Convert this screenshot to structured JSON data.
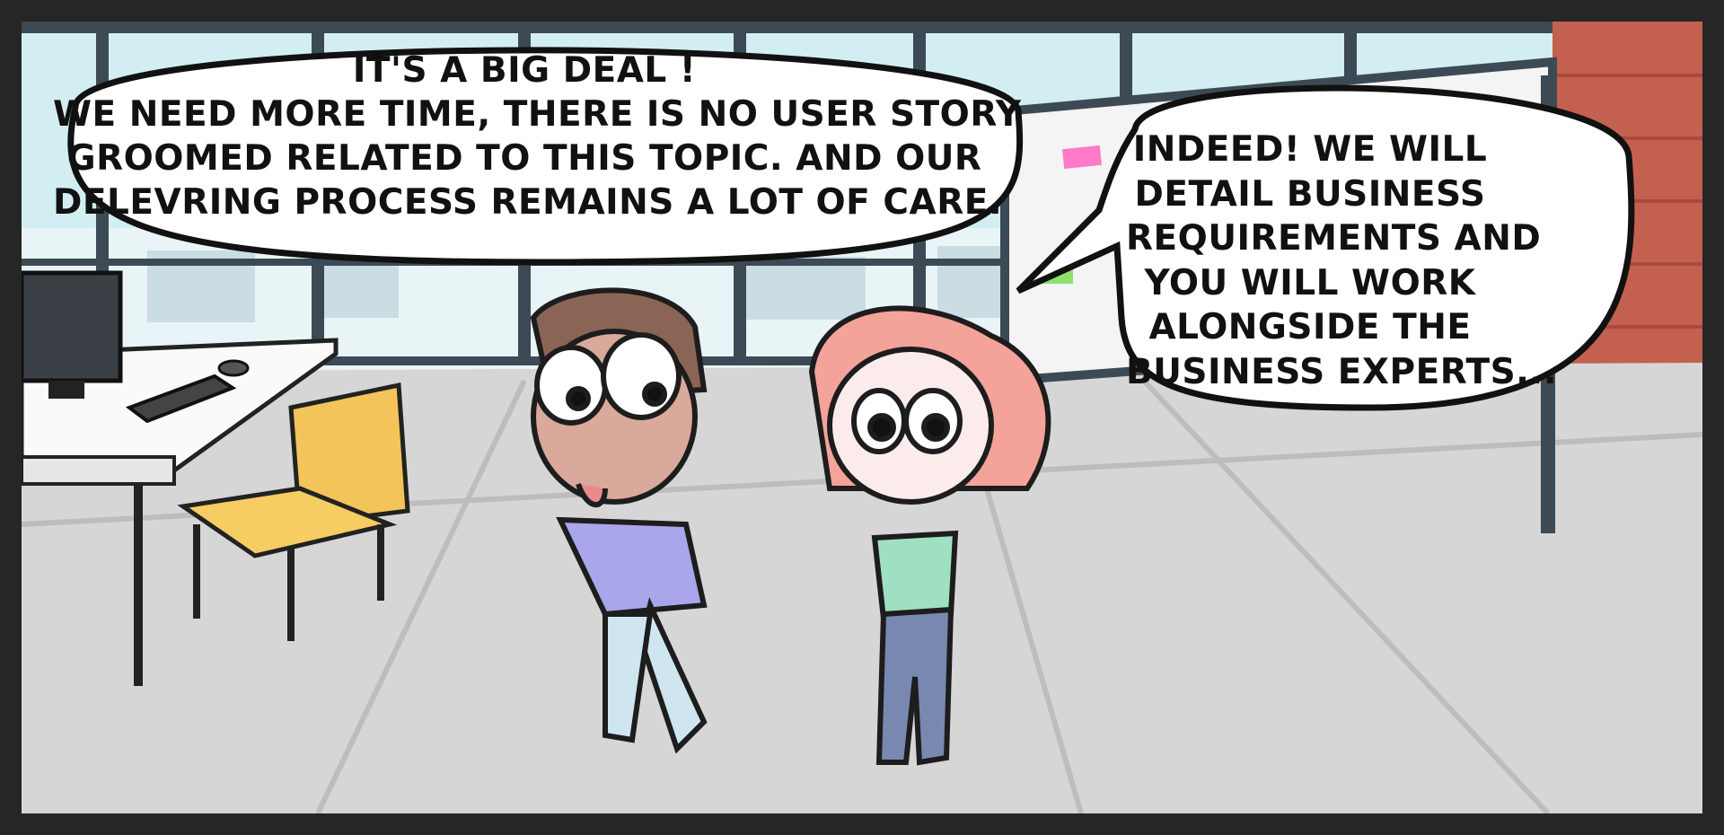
{
  "comic_panel": {
    "left_speech_bubble": {
      "lines": [
        "IT'S A BIG DEAL !",
        "WE NEED MORE TIME, THERE IS NO USER STORY",
        "GROOMED RELATED TO THIS TOPIC. AND OUR",
        "DELEVRING PROCESS REMAINS A LOT OF CARE."
      ]
    },
    "right_speech_bubble": {
      "lines": [
        "INDEED! WE WILL",
        "DETAIL BUSINESS",
        "REQUIREMENTS AND",
        "YOU WILL WORK",
        "ALONGSIDE THE",
        "BUSINESS EXPERTS..."
      ]
    },
    "colors": {
      "frame": "#262626",
      "floor": "#d6d6d6",
      "window_sky": "#d3eef2",
      "brick_wall": "#c4604f",
      "chair": "#f2c45a",
      "man_shirt": "#a9a6ec",
      "woman_hair": "#f3a39a",
      "woman_shirt": "#9fe0c3"
    },
    "icons": [
      "computer-monitor-icon",
      "keyboard-icon",
      "mouse-icon",
      "chair-icon",
      "whiteboard-icon"
    ]
  }
}
